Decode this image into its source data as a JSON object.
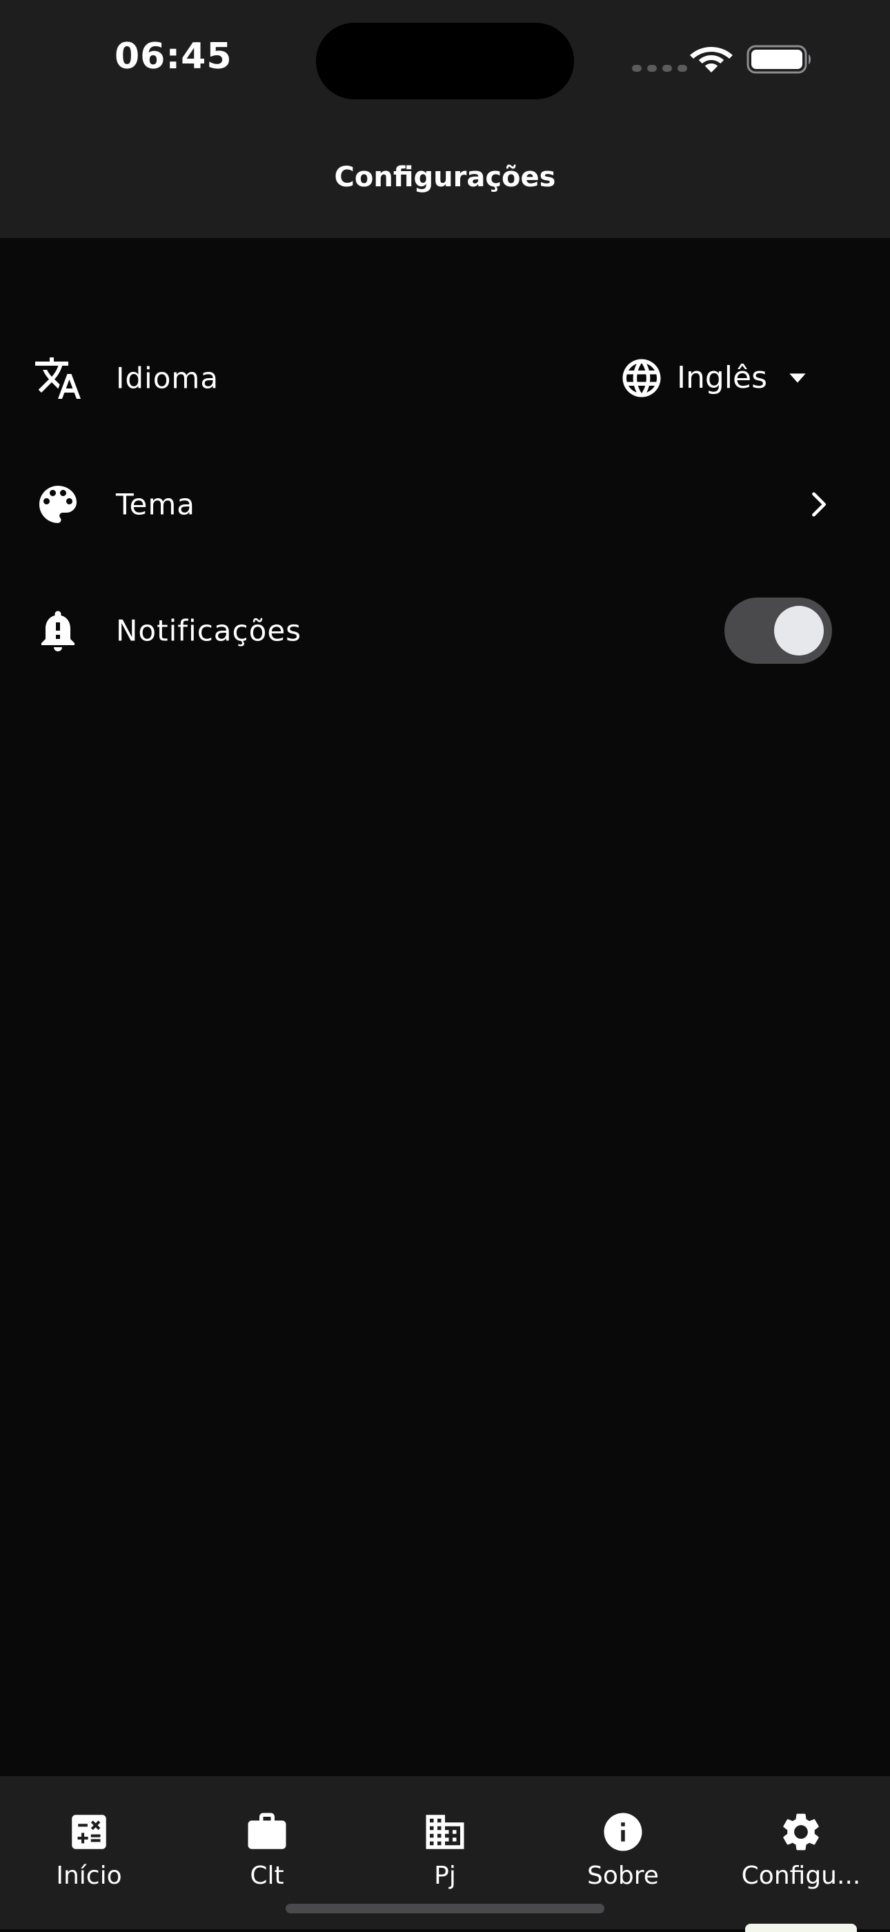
{
  "status_bar": {
    "time": "06:45"
  },
  "header": {
    "title": "Configurações"
  },
  "settings": {
    "language": {
      "label": "Idioma",
      "icon": "translate-icon",
      "value": "Inglês",
      "value_icon": "globe-icon"
    },
    "theme": {
      "label": "Tema",
      "icon": "palette-icon"
    },
    "notifications": {
      "label": "Notificações",
      "icon": "bell-alert-icon",
      "enabled": true
    }
  },
  "bottom_nav": {
    "items": [
      {
        "label": "Início",
        "icon": "calculator-icon"
      },
      {
        "label": "Clt",
        "icon": "briefcase-icon"
      },
      {
        "label": "Pj",
        "icon": "building-icon"
      },
      {
        "label": "Sobre",
        "icon": "info-icon"
      },
      {
        "label": "Configu...",
        "icon": "gear-icon"
      }
    ],
    "active_index": 4
  },
  "colors": {
    "background": "#0a090a",
    "surface": "#1e1e1f",
    "text": "#ffffff",
    "toggle_track": "#4a4a4c",
    "toggle_knob": "#e6e8ec"
  }
}
